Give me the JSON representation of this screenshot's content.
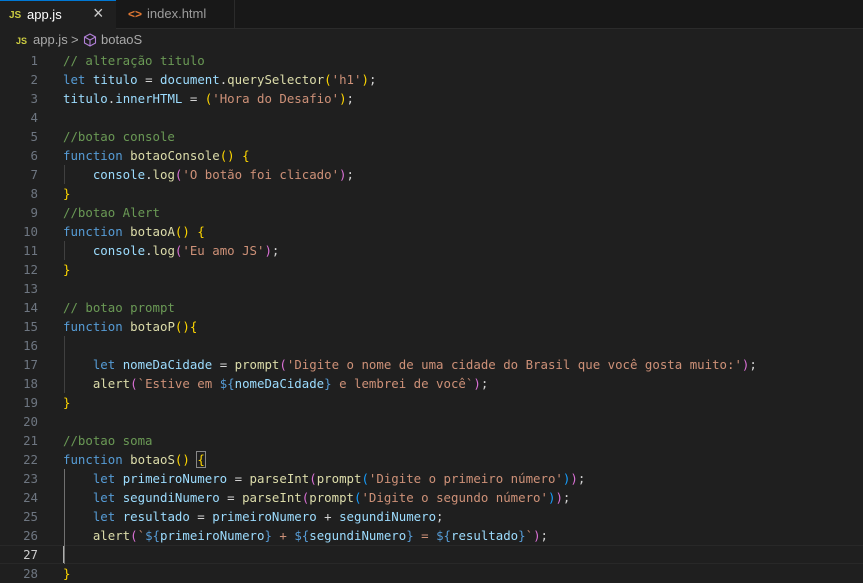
{
  "tabs": [
    {
      "label": "app.js",
      "icon": "js-file-icon",
      "icon_text": "JS",
      "active": true
    },
    {
      "label": "index.html",
      "icon": "html-file-icon",
      "icon_text": "<>",
      "active": false
    }
  ],
  "tab_close": "×",
  "breadcrumb": {
    "file_icon_text": "JS",
    "file": "app.js",
    "separator": ">",
    "symbol": "botaoS",
    "symbol_icon": "cube-icon"
  },
  "editor": {
    "current_line": 27,
    "lines": [
      {
        "n": 1,
        "tokens": [
          {
            "t": "// alteração titulo",
            "c": "comment"
          }
        ]
      },
      {
        "n": 2,
        "tokens": [
          {
            "t": "let",
            "c": "kw"
          },
          {
            "t": " ",
            "c": "plain"
          },
          {
            "t": "titulo",
            "c": "var"
          },
          {
            "t": " = ",
            "c": "op"
          },
          {
            "t": "document",
            "c": "var"
          },
          {
            "t": ".",
            "c": "op"
          },
          {
            "t": "querySelector",
            "c": "fn"
          },
          {
            "t": "(",
            "c": "b1"
          },
          {
            "t": "'h1'",
            "c": "str"
          },
          {
            "t": ")",
            "c": "b1"
          },
          {
            "t": ";",
            "c": "op"
          }
        ]
      },
      {
        "n": 3,
        "tokens": [
          {
            "t": "titulo",
            "c": "var"
          },
          {
            "t": ".",
            "c": "op"
          },
          {
            "t": "innerHTML",
            "c": "var"
          },
          {
            "t": " = ",
            "c": "op"
          },
          {
            "t": "(",
            "c": "b1"
          },
          {
            "t": "'Hora do Desafio'",
            "c": "str"
          },
          {
            "t": ")",
            "c": "b1"
          },
          {
            "t": ";",
            "c": "op"
          }
        ]
      },
      {
        "n": 4,
        "tokens": []
      },
      {
        "n": 5,
        "tokens": [
          {
            "t": "//botao console",
            "c": "comment"
          }
        ]
      },
      {
        "n": 6,
        "tokens": [
          {
            "t": "function",
            "c": "kw"
          },
          {
            "t": " ",
            "c": "plain"
          },
          {
            "t": "botaoConsole",
            "c": "fn"
          },
          {
            "t": "()",
            "c": "b1"
          },
          {
            "t": " ",
            "c": "plain"
          },
          {
            "t": "{",
            "c": "b1"
          }
        ]
      },
      {
        "n": 7,
        "tokens": [
          {
            "t": "    ",
            "c": "plain"
          },
          {
            "t": "console",
            "c": "var"
          },
          {
            "t": ".",
            "c": "op"
          },
          {
            "t": "log",
            "c": "fn"
          },
          {
            "t": "(",
            "c": "b2"
          },
          {
            "t": "'O botão foi clicado'",
            "c": "str"
          },
          {
            "t": ")",
            "c": "b2"
          },
          {
            "t": ";",
            "c": "op"
          }
        ]
      },
      {
        "n": 8,
        "tokens": [
          {
            "t": "}",
            "c": "b1"
          }
        ]
      },
      {
        "n": 9,
        "tokens": [
          {
            "t": "//botao Alert",
            "c": "comment"
          }
        ]
      },
      {
        "n": 10,
        "tokens": [
          {
            "t": "function",
            "c": "kw"
          },
          {
            "t": " ",
            "c": "plain"
          },
          {
            "t": "botaoA",
            "c": "fn"
          },
          {
            "t": "()",
            "c": "b1"
          },
          {
            "t": " ",
            "c": "plain"
          },
          {
            "t": "{",
            "c": "b1"
          }
        ]
      },
      {
        "n": 11,
        "tokens": [
          {
            "t": "    ",
            "c": "plain"
          },
          {
            "t": "console",
            "c": "var"
          },
          {
            "t": ".",
            "c": "op"
          },
          {
            "t": "log",
            "c": "fn"
          },
          {
            "t": "(",
            "c": "b2"
          },
          {
            "t": "'Eu amo JS'",
            "c": "str"
          },
          {
            "t": ")",
            "c": "b2"
          },
          {
            "t": ";",
            "c": "op"
          }
        ]
      },
      {
        "n": 12,
        "tokens": [
          {
            "t": "}",
            "c": "b1"
          }
        ]
      },
      {
        "n": 13,
        "tokens": []
      },
      {
        "n": 14,
        "tokens": [
          {
            "t": "// botao prompt",
            "c": "comment"
          }
        ]
      },
      {
        "n": 15,
        "tokens": [
          {
            "t": "function",
            "c": "kw"
          },
          {
            "t": " ",
            "c": "plain"
          },
          {
            "t": "botaoP",
            "c": "fn"
          },
          {
            "t": "()",
            "c": "b1"
          },
          {
            "t": "{",
            "c": "b1"
          }
        ]
      },
      {
        "n": 16,
        "tokens": []
      },
      {
        "n": 17,
        "tokens": [
          {
            "t": "    ",
            "c": "plain"
          },
          {
            "t": "let",
            "c": "kw"
          },
          {
            "t": " ",
            "c": "plain"
          },
          {
            "t": "nomeDaCidade",
            "c": "var"
          },
          {
            "t": " = ",
            "c": "op"
          },
          {
            "t": "prompt",
            "c": "fn"
          },
          {
            "t": "(",
            "c": "b2"
          },
          {
            "t": "'Digite o nome de uma cidade do Brasil que você gosta muito:'",
            "c": "str"
          },
          {
            "t": ")",
            "c": "b2"
          },
          {
            "t": ";",
            "c": "op"
          }
        ]
      },
      {
        "n": 18,
        "tokens": [
          {
            "t": "    ",
            "c": "plain"
          },
          {
            "t": "alert",
            "c": "fn"
          },
          {
            "t": "(",
            "c": "b2"
          },
          {
            "t": "`Estive em ",
            "c": "str"
          },
          {
            "t": "${",
            "c": "kw"
          },
          {
            "t": "nomeDaCidade",
            "c": "var"
          },
          {
            "t": "}",
            "c": "kw"
          },
          {
            "t": " e lembrei de você`",
            "c": "str"
          },
          {
            "t": ")",
            "c": "b2"
          },
          {
            "t": ";",
            "c": "op"
          }
        ]
      },
      {
        "n": 19,
        "tokens": [
          {
            "t": "}",
            "c": "b1"
          }
        ]
      },
      {
        "n": 20,
        "tokens": []
      },
      {
        "n": 21,
        "tokens": [
          {
            "t": "//botao soma",
            "c": "comment"
          }
        ]
      },
      {
        "n": 22,
        "tokens": [
          {
            "t": "function",
            "c": "kw"
          },
          {
            "t": " ",
            "c": "plain"
          },
          {
            "t": "botaoS",
            "c": "fn"
          },
          {
            "t": "()",
            "c": "b1"
          },
          {
            "t": " ",
            "c": "plain"
          },
          {
            "t": "{",
            "c": "b1",
            "box": true
          }
        ]
      },
      {
        "n": 23,
        "tokens": [
          {
            "t": "    ",
            "c": "plain"
          },
          {
            "t": "let",
            "c": "kw"
          },
          {
            "t": " ",
            "c": "plain"
          },
          {
            "t": "primeiroNumero",
            "c": "var"
          },
          {
            "t": " = ",
            "c": "op"
          },
          {
            "t": "parseInt",
            "c": "fn"
          },
          {
            "t": "(",
            "c": "b2"
          },
          {
            "t": "prompt",
            "c": "fn"
          },
          {
            "t": "(",
            "c": "b3"
          },
          {
            "t": "'Digite o primeiro número'",
            "c": "str"
          },
          {
            "t": ")",
            "c": "b3"
          },
          {
            "t": ")",
            "c": "b2"
          },
          {
            "t": ";",
            "c": "op"
          }
        ]
      },
      {
        "n": 24,
        "tokens": [
          {
            "t": "    ",
            "c": "plain"
          },
          {
            "t": "let",
            "c": "kw"
          },
          {
            "t": " ",
            "c": "plain"
          },
          {
            "t": "segundiNumero",
            "c": "var"
          },
          {
            "t": " = ",
            "c": "op"
          },
          {
            "t": "parseInt",
            "c": "fn"
          },
          {
            "t": "(",
            "c": "b2"
          },
          {
            "t": "prompt",
            "c": "fn"
          },
          {
            "t": "(",
            "c": "b3"
          },
          {
            "t": "'Digite o segundo número'",
            "c": "str"
          },
          {
            "t": ")",
            "c": "b3"
          },
          {
            "t": ")",
            "c": "b2"
          },
          {
            "t": ";",
            "c": "op"
          }
        ]
      },
      {
        "n": 25,
        "tokens": [
          {
            "t": "    ",
            "c": "plain"
          },
          {
            "t": "let",
            "c": "kw"
          },
          {
            "t": " ",
            "c": "plain"
          },
          {
            "t": "resultado",
            "c": "var"
          },
          {
            "t": " = ",
            "c": "op"
          },
          {
            "t": "primeiroNumero",
            "c": "var"
          },
          {
            "t": " + ",
            "c": "op"
          },
          {
            "t": "segundiNumero",
            "c": "var"
          },
          {
            "t": ";",
            "c": "op"
          }
        ]
      },
      {
        "n": 26,
        "tokens": [
          {
            "t": "    ",
            "c": "plain"
          },
          {
            "t": "alert",
            "c": "fn"
          },
          {
            "t": "(",
            "c": "b2"
          },
          {
            "t": "`",
            "c": "str"
          },
          {
            "t": "${",
            "c": "kw"
          },
          {
            "t": "primeiroNumero",
            "c": "var"
          },
          {
            "t": "}",
            "c": "kw"
          },
          {
            "t": " + ",
            "c": "str"
          },
          {
            "t": "${",
            "c": "kw"
          },
          {
            "t": "segundiNumero",
            "c": "var"
          },
          {
            "t": "}",
            "c": "kw"
          },
          {
            "t": " = ",
            "c": "str"
          },
          {
            "t": "${",
            "c": "kw"
          },
          {
            "t": "resultado",
            "c": "var"
          },
          {
            "t": "}",
            "c": "kw"
          },
          {
            "t": "`",
            "c": "str"
          },
          {
            "t": ")",
            "c": "b2"
          },
          {
            "t": ";",
            "c": "op"
          }
        ]
      },
      {
        "n": 27,
        "tokens": []
      },
      {
        "n": 28,
        "tokens": [
          {
            "t": "}",
            "c": "b1"
          }
        ]
      }
    ]
  }
}
